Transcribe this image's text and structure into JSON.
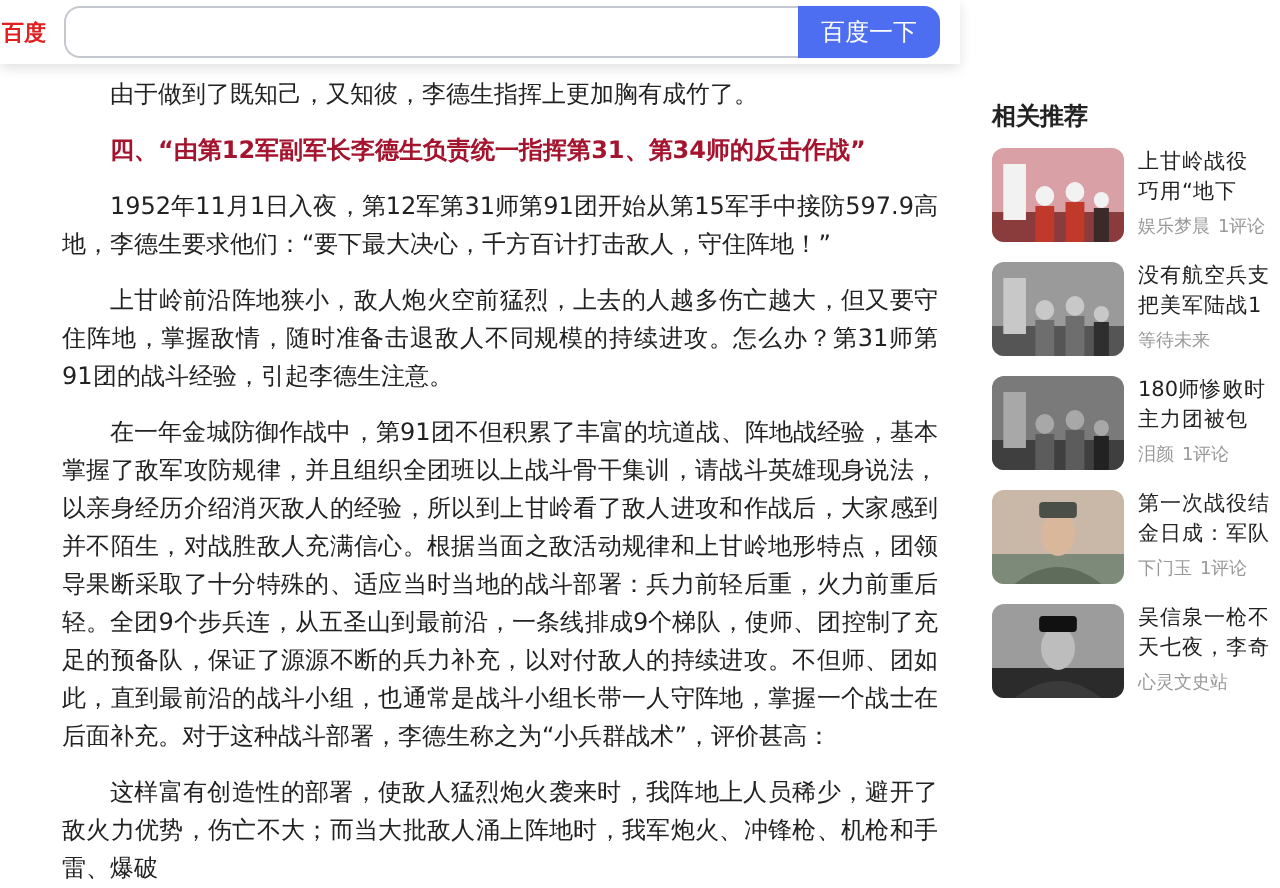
{
  "header": {
    "logo": "百度",
    "button": "百度一下"
  },
  "article": [
    {
      "kind": "text",
      "text": "由于做到了既知己，又知彼，李德生指挥上更加胸有成竹了。"
    },
    {
      "kind": "heading",
      "text": "四、“由第12军副军长李德生负责统一指挥第31、第34师的反击作战”"
    },
    {
      "kind": "text",
      "text": "1952年11月1日入夜，第12军第31师第91团开始从第15军手中接防597.9高地，李德生要求他们：“要下最大决心，千方百计打击敌人，守住阵地！”"
    },
    {
      "kind": "text",
      "text": "上甘岭前沿阵地狭小，敌人炮火空前猛烈，上去的人越多伤亡越大，但又要守住阵地，掌握敌情，随时准备击退敌人不同规模的持续进攻。怎么办？第31师第91团的战斗经验，引起李德生注意。"
    },
    {
      "kind": "text",
      "text": "在一年金城防御作战中，第91团不但积累了丰富的坑道战、阵地战经验，基本掌握了敌军攻防规律，并且组织全团班以上战斗骨干集训，请战斗英雄现身说法，以亲身经历介绍消灭敌人的经验，所以到上甘岭看了敌人进攻和作战后，大家感到并不陌生，对战胜敌人充满信心。根据当面之敌活动规律和上甘岭地形特点，团领导果断采取了十分特殊的、适应当时当地的战斗部署：兵力前轻后重，火力前重后轻。全团9个步兵连，从五圣山到最前沿，一条线排成9个梯队，使师、团控制了充足的预备队，保证了源源不断的兵力补充，以对付敌人的持续进攻。不但师、团如此，直到最前沿的战斗小组，也通常是战斗小组长带一人守阵地，掌握一个战士在后面补充。对于这种战斗部署，李德生称之为“小兵群战术”，评价甚高："
    },
    {
      "kind": "text",
      "text": "这样富有创造性的部署，使敌人猛烈炮火袭来时，我阵地上人员稀少，避开了敌火力优势，伤亡不大；而当大批敌人涌上阵地时，我军炮火、冲锋枪、机枪和手雷、爆破"
    }
  ],
  "related": {
    "title": "相关推荐",
    "items": [
      {
        "kind": "picture",
        "lines": [
          "上甘岭战役",
          "巧用“地下"
        ],
        "source": "娱乐梦晨",
        "comments": "1评论"
      },
      {
        "kind": "picture",
        "lines": [
          "没有航空兵支",
          "把美军陆战1"
        ],
        "source": "等待未来"
      },
      {
        "kind": "picture",
        "lines": [
          "180师惨败时",
          "主力团被包"
        ],
        "source": "泪颜",
        "comments": "1评论"
      },
      {
        "kind": "picture",
        "lines": [
          "第一次战役结",
          "金日成：军队"
        ],
        "source": "下门玉",
        "comments": "1评论"
      },
      {
        "kind": "picture",
        "lines": [
          "吴信泉一枪不",
          "天七夜，李奇"
        ],
        "source": "心灵文史站"
      }
    ]
  }
}
